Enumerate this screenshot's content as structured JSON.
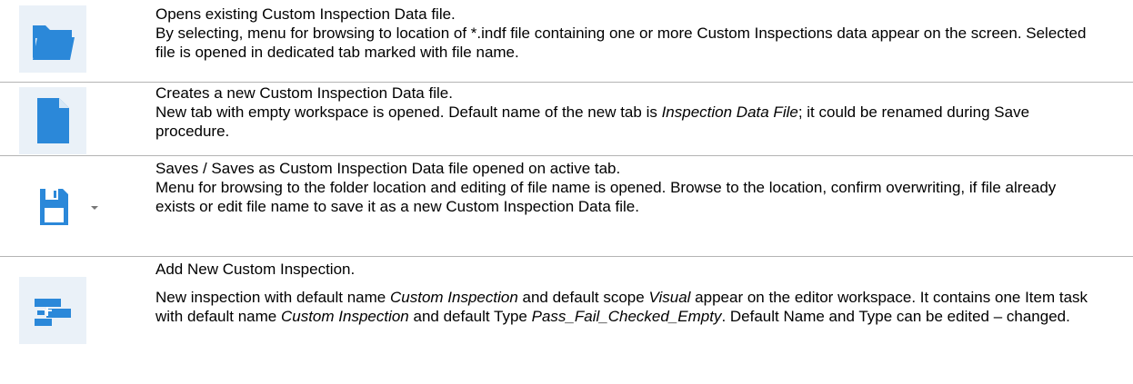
{
  "rows": [
    {
      "icon": "folder-open-icon",
      "title": "Opens existing Custom Inspection Data file.",
      "body": "By selecting, menu for browsing to location of *.indf file containing one or more Custom Inspections data appear on the screen. Selected file is opened in dedicated tab marked with file name."
    },
    {
      "icon": "new-file-icon",
      "title": "Creates a new Custom Inspection Data file.",
      "body_a": "New tab with empty workspace is opened. Default name of the new tab is ",
      "body_em": "Inspection Data File",
      "body_b": "; it could be renamed during Save procedure."
    },
    {
      "icon": "save-icon",
      "dropdown_icon": "chevron-down-icon",
      "title": "Saves / Saves as Custom Inspection Data file opened on active tab.",
      "body": "Menu for browsing to the folder location and editing of file name is opened. Browse to the location, confirm overwriting, if file already exists or edit file name to save it as a new Custom Inspection Data file."
    },
    {
      "icon": "add-inspection-icon",
      "title": "Add New Custom Inspection.",
      "b1": "New inspection with default name ",
      "b1_em": "Custom Inspection",
      "b2": " and default scope ",
      "b2_em": "Visual",
      "b3": " appear on the editor workspace. It contains one Item task with default name ",
      "b3_em": "Custom Inspection",
      "b4": " and default Type ",
      "b4_em": "Pass_Fail_Checked_Empty",
      "b5": ". Default Name and Type can be edited – changed."
    }
  ],
  "colors": {
    "accent": "#2b88d9",
    "icon_bg": "#eaf1f8",
    "separator": "#b4b4b4"
  }
}
